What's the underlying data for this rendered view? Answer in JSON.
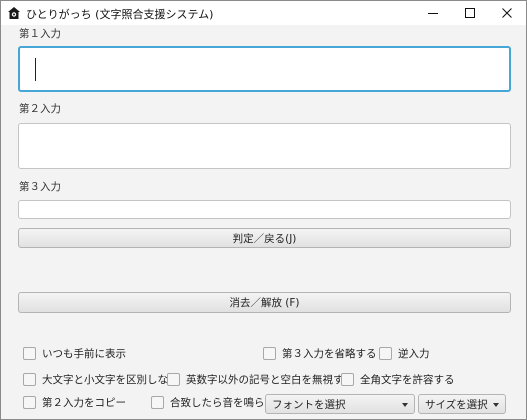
{
  "window": {
    "title": "ひとりがっち (文字照合支援システム)"
  },
  "inputs": {
    "input1_label": "第１入力",
    "input2_label": "第２入力",
    "input3_label": "第３入力"
  },
  "buttons": {
    "judge_label": "判定／戻る(J)",
    "clear_label": "消去／解放 (F)"
  },
  "options": {
    "always_on_top": "いつも手前に表示",
    "skip_input3": "第３入力を省略する",
    "reverse_input": "逆入力",
    "ignore_case": "大文字と小文字を区別しない",
    "ignore_symbols": "英数字以外の記号と空白を無視する",
    "allow_fullwidth": "全角文字を許容する",
    "copy_input2": "第２入力をコピー",
    "sound_on_match": "合致したら音を鳴らす"
  },
  "selects": {
    "font_label": "フォントを選択",
    "size_label": "サイズを選択"
  }
}
